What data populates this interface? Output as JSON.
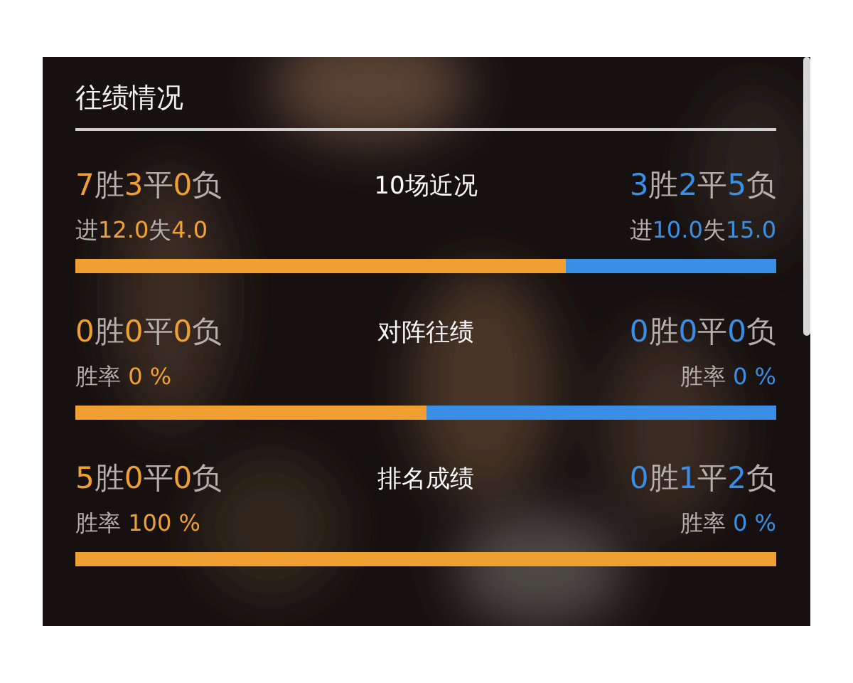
{
  "title": "往绩情况",
  "rows": [
    {
      "label": "10场近况",
      "home": {
        "record": "7胜3平0负",
        "detail": "进12.0失4.0"
      },
      "away": {
        "record": "3胜2平5负",
        "detail": "进10.0失15.0"
      },
      "level": 0.7
    },
    {
      "label": "对阵往绩",
      "home": {
        "record": "0胜0平0负",
        "detail": "胜率 0 %"
      },
      "away": {
        "record": "0胜0平0负",
        "detail": "胜率 0 %"
      },
      "level": 0.5
    },
    {
      "label": "排名成绩",
      "home": {
        "record": "5胜0平0负",
        "detail": "胜率 100 %"
      },
      "away": {
        "record": "0胜1平2负",
        "detail": "胜率 0 %"
      },
      "level": 1
    }
  ]
}
